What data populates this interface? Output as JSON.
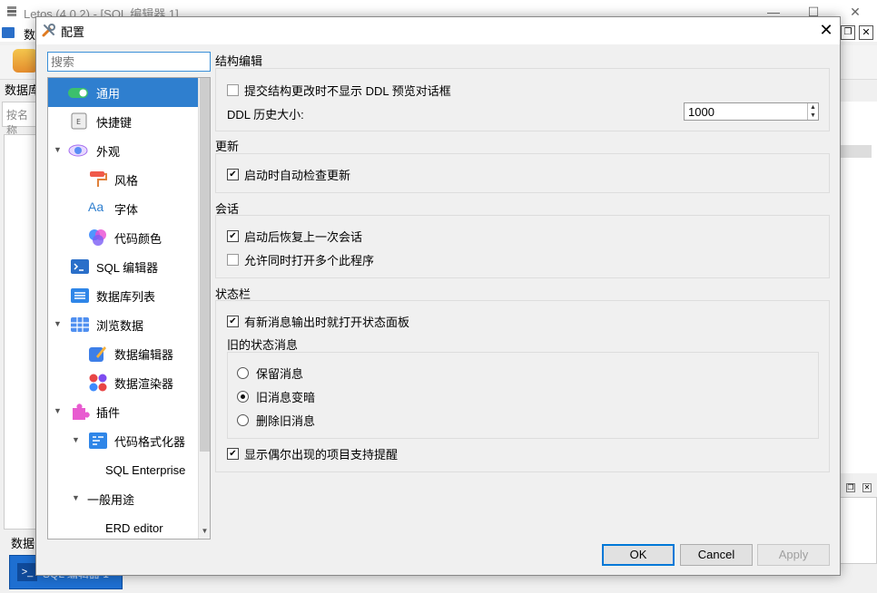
{
  "main_window": {
    "title": "Letos (4.0.2) - [SQL 编辑器 1]",
    "menu_label": "数",
    "left_label": "数据库",
    "filter_placeholder": "按名称",
    "left_bottom_label": "数据",
    "task_button_label": "SQL 编辑器 1"
  },
  "dialog": {
    "title": "配置",
    "close_label": "✕",
    "search_placeholder": "搜索",
    "tree": [
      {
        "label": "通用",
        "icon": "toggle-icon",
        "selected": true
      },
      {
        "label": "快捷键",
        "icon": "keyboard-key-icon"
      },
      {
        "label": "外观",
        "icon": "eye-icon",
        "expanded": true
      },
      {
        "label": "风格",
        "icon": "paint-roller-icon"
      },
      {
        "label": "字体",
        "icon": "font-aa-icon",
        "icon_text": "Aa"
      },
      {
        "label": "代码颜色",
        "icon": "color-circles-icon"
      },
      {
        "label": "SQL 编辑器",
        "icon": "terminal-icon"
      },
      {
        "label": "数据库列表",
        "icon": "list-icon"
      },
      {
        "label": "浏览数据",
        "icon": "grid-table-icon",
        "expanded": true
      },
      {
        "label": "数据编辑器",
        "icon": "edit-pencil-icon"
      },
      {
        "label": "数据渲染器",
        "icon": "colored-dots-icon"
      },
      {
        "label": "插件",
        "icon": "puzzle-icon",
        "expanded": true
      },
      {
        "label": "代码格式化器",
        "icon": "code-format-icon",
        "expanded": true
      },
      {
        "label": "SQL Enterprise"
      },
      {
        "label": "一般用途",
        "expanded": true
      },
      {
        "label": "ERD editor"
      }
    ],
    "sections": {
      "structure": {
        "title": "结构编辑",
        "no_ddl_preview_label": "提交结构更改时不显示 DDL 预览对话框",
        "no_ddl_preview_checked": false,
        "ddl_history_label": "DDL 历史大小:",
        "ddl_history_value": "1000"
      },
      "update": {
        "title": "更新",
        "auto_check_label": "启动时自动检查更新",
        "auto_check_checked": true
      },
      "session": {
        "title": "会话",
        "restore_label": "启动后恢复上一次会话",
        "restore_checked": true,
        "multi_instance_label": "允许同时打开多个此程序",
        "multi_instance_checked": false
      },
      "statusbar": {
        "title": "状态栏",
        "open_on_new_label": "有新消息输出时就打开状态面板",
        "open_on_new_checked": true,
        "old_messages_label": "旧的状态消息",
        "options": [
          {
            "label": "保留消息",
            "selected": false
          },
          {
            "label": "旧消息变暗",
            "selected": true
          },
          {
            "label": "删除旧消息",
            "selected": false
          }
        ],
        "hints_label": "显示偶尔出现的项目支持提醒",
        "hints_checked": true
      }
    },
    "buttons": {
      "ok": "OK",
      "cancel": "Cancel",
      "apply": "Apply"
    }
  },
  "colors": {
    "selection": "#2f7fcf",
    "focus_border": "#3a8fd8",
    "default_button_border": "#0078d7"
  }
}
